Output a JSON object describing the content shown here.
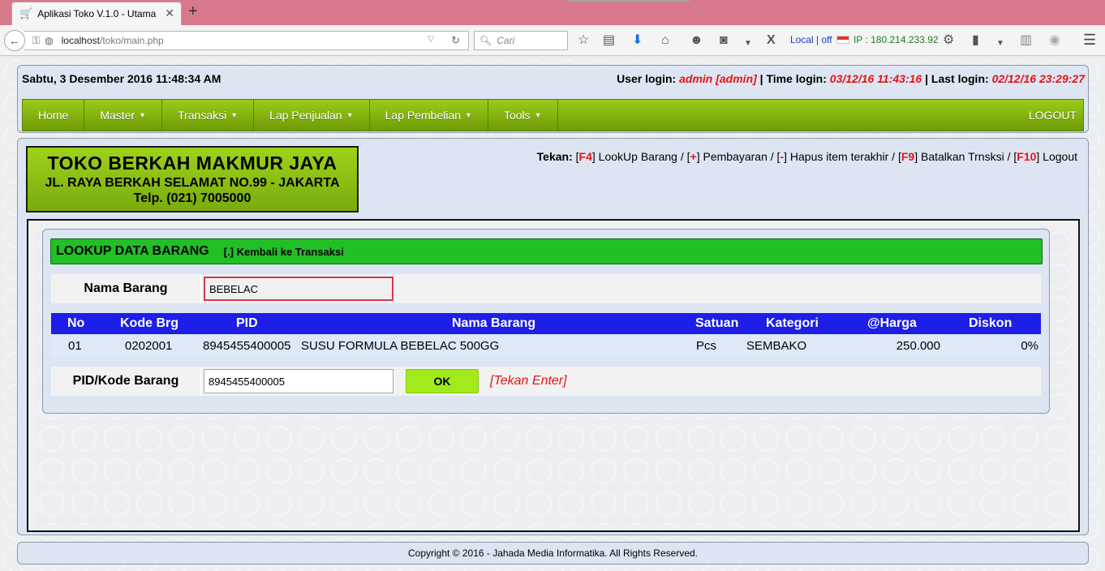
{
  "browser": {
    "tab_title": "Aplikasi Toko V.1.0 - Utama",
    "url_host": "localhost",
    "url_path": "/toko/main.php",
    "search_placeholder": "Cari",
    "status_text": "Local | off",
    "ip_text": "IP : 180.214.233.92"
  },
  "header": {
    "datetime": "Sabtu, 3 Desember 2016 11:48:34 AM",
    "user_login_label": "User login:",
    "user_login_value": "admin [admin]",
    "time_login_label": "Time login:",
    "time_login_value": "03/12/16 11:43:16",
    "last_login_label": "Last login:",
    "last_login_value": "02/12/16 23:29:27",
    "separator": "|"
  },
  "menu": {
    "items": [
      {
        "label": "Home",
        "has_dropdown": false
      },
      {
        "label": "Master",
        "has_dropdown": true
      },
      {
        "label": "Transaksi",
        "has_dropdown": true
      },
      {
        "label": "Lap Penjualan",
        "has_dropdown": true
      },
      {
        "label": "Lap Pembelian",
        "has_dropdown": true
      },
      {
        "label": "Tools",
        "has_dropdown": true
      }
    ],
    "logout": "LOGOUT"
  },
  "store": {
    "name": "TOKO BERKAH MAKMUR JAYA",
    "address": "JL. RAYA BERKAH SELAMAT NO.99 - JAKARTA",
    "phone": "Telp. (021) 7005000"
  },
  "shortcuts": {
    "prefix": "Tekan:",
    "items": [
      {
        "key": "F4",
        "desc": "LookUp Barang"
      },
      {
        "key": "+",
        "desc": "Pembayaran"
      },
      {
        "key": "-",
        "desc": "Hapus item terakhir"
      },
      {
        "key": "F9",
        "desc": "Batalkan Trnsksi"
      },
      {
        "key": "F10",
        "desc": "Logout"
      }
    ]
  },
  "lookup": {
    "title": "LOOKUP DATA BARANG",
    "back_link": "[.] Kembali ke Transaksi",
    "nama_label": "Nama Barang",
    "nama_value": "BEBELAC",
    "columns": [
      "No",
      "Kode Brg",
      "PID",
      "Nama Barang",
      "Satuan",
      "Kategori",
      "@Harga",
      "Diskon"
    ],
    "rows": [
      {
        "no": "01",
        "kode": "0202001",
        "pid": "8945455400005",
        "nama": "SUSU FORMULA BEBELAC 500GG",
        "satuan": "Pcs",
        "kategori": "SEMBAKO",
        "harga": "250.000",
        "diskon": "0%"
      }
    ],
    "pid_label": "PID/Kode Barang",
    "pid_value": "8945455400005",
    "ok_label": "OK",
    "hint": "[Tekan Enter]"
  },
  "footer": {
    "copyright": "Copyright © 2016 - Jahada Media Informatika. All Rights Reserved."
  }
}
